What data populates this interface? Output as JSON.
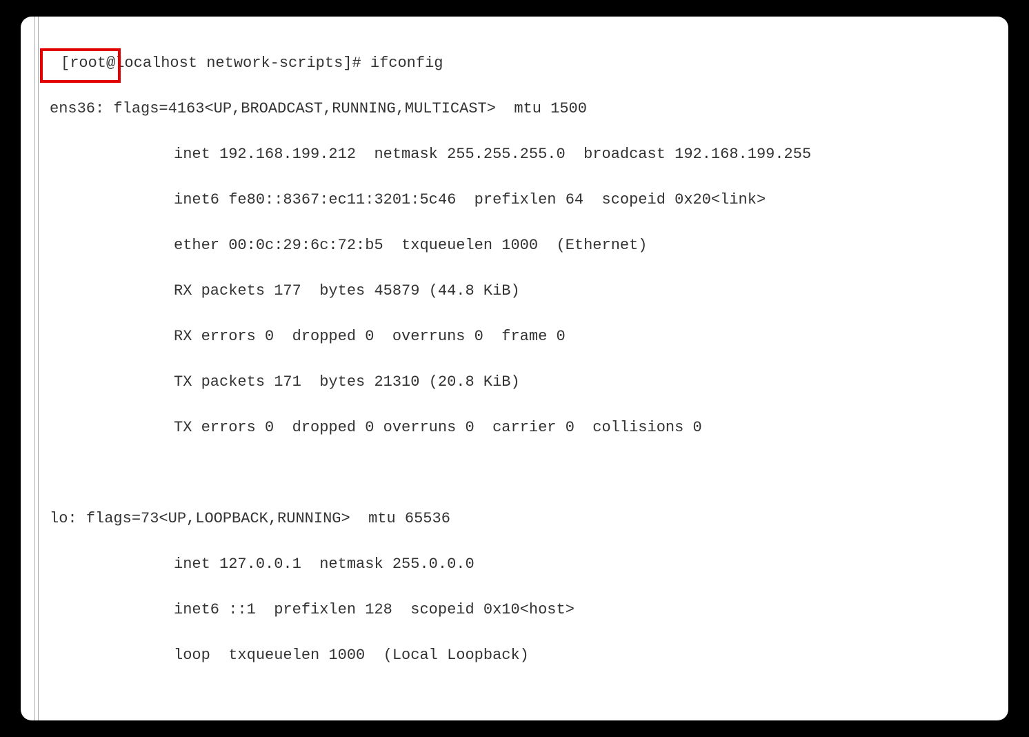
{
  "prompt": "[root@localhost network-scripts]# ",
  "command": "ifconfig",
  "ifaces": [
    {
      "name": "ens36:",
      "flags": "flags=4163<UP,BROADCAST,RUNNING,MULTICAST>  mtu 1500",
      "lines": [
        "inet 192.168.199.212  netmask 255.255.255.0  broadcast 192.168.199.255",
        "inet6 fe80::8367:ec11:3201:5c46  prefixlen 64  scopeid 0x20<link>",
        "ether 00:0c:29:6c:72:b5  txqueuelen 1000  (Ethernet)",
        "RX packets 177  bytes 45879 (44.8 KiB)",
        "RX errors 0  dropped 0  overruns 0  frame 0",
        "TX packets 171  bytes 21310 (20.8 KiB)",
        "TX errors 0  dropped 0 overruns 0  carrier 0  collisions 0"
      ]
    },
    {
      "name": "lo:",
      "flags": "flags=73<UP,LOOPBACK,RUNNING>  mtu 65536",
      "lines": [
        "inet 127.0.0.1  netmask 255.0.0.0",
        "inet6 ::1  prefixlen 128  scopeid 0x10<host>",
        "loop  txqueuelen 1000  (Local Loopback)"
      ]
    }
  ]
}
